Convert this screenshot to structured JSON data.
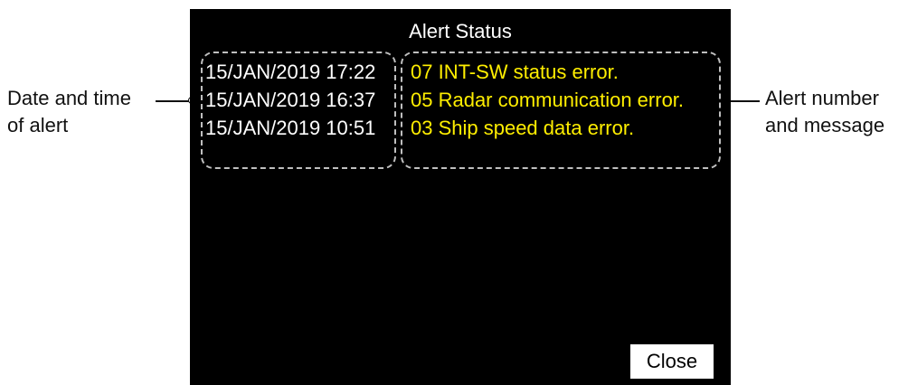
{
  "dialog": {
    "title": "Alert Status",
    "close_label": "Close"
  },
  "alerts": [
    {
      "datetime": "15/JAN/2019 17:22",
      "message": "07 INT-SW status error."
    },
    {
      "datetime": "15/JAN/2019 16:37",
      "message": "05 Radar communication error."
    },
    {
      "datetime": "15/JAN/2019 10:51",
      "message": "03 Ship speed data error."
    }
  ],
  "callouts": {
    "left": {
      "line1": "Date and time",
      "line2": "of alert"
    },
    "right": {
      "line1": "Alert number",
      "line2": "and message"
    }
  },
  "colors": {
    "screen_background": "#000000",
    "date_text": "#ffffff",
    "message_text": "#ffee00",
    "group_outline": "#bfbfbf"
  }
}
